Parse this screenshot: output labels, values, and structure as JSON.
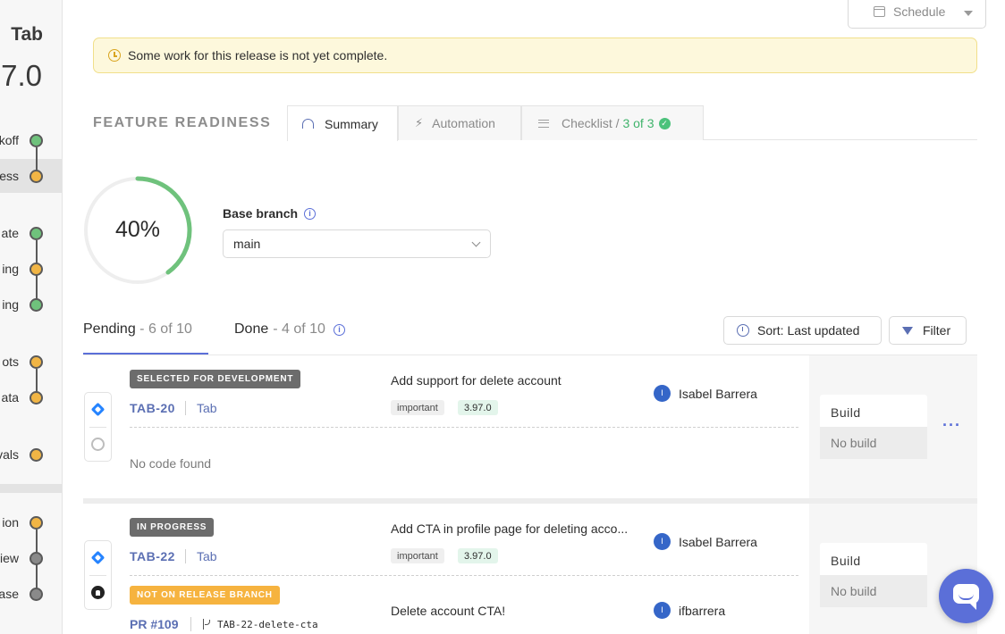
{
  "sidebar": {
    "title": "Tab",
    "version": "7.0",
    "steps": [
      {
        "label": "koff",
        "status": "green"
      },
      {
        "label": "ess",
        "status": "yellow",
        "active": true
      },
      {
        "label": "ate",
        "status": "green"
      },
      {
        "label": "ing",
        "status": "yellow"
      },
      {
        "label": "ing",
        "status": "green"
      },
      {
        "label": "ots",
        "status": "yellow"
      },
      {
        "label": "ata",
        "status": "yellow"
      },
      {
        "label": "vals",
        "status": "yellow"
      },
      {
        "label": "ion",
        "status": "yellow"
      },
      {
        "label": "iew",
        "status": "gray"
      },
      {
        "label": "ase",
        "status": "gray"
      }
    ]
  },
  "header": {
    "schedule_label": "Schedule"
  },
  "warning": {
    "text": "Some work for this release is not yet complete."
  },
  "readiness": {
    "title": "FEATURE READINESS",
    "tabs": {
      "summary": "Summary",
      "automation": "Automation",
      "checklist_prefix": "Checklist / ",
      "checklist_count": "3 of 3"
    },
    "progress_text": "40%",
    "progress_value": 0.4,
    "base_branch_label": "Base branch",
    "base_branch_value": "main"
  },
  "list": {
    "pending_label": "Pending",
    "pending_count": "- 6 of 10",
    "done_label": "Done",
    "done_count": "- 4 of 10",
    "sort_label": "Sort: Last updated",
    "filter_label": "Filter",
    "items": [
      {
        "status": "SELECTED FOR DEVELOPMENT",
        "key": "TAB-20",
        "project": "Tab",
        "title": "Add support for delete account",
        "tags": [
          "important",
          "3.97.0"
        ],
        "assignee": "Isabel Barrera",
        "assignee_initial": "I",
        "no_code": "No code found",
        "build_label": "Build",
        "build_value": "No build"
      },
      {
        "status": "IN PROGRESS",
        "key": "TAB-22",
        "project": "Tab",
        "title": "Add CTA in profile page for deleting acco...",
        "tags": [
          "important",
          "3.97.0"
        ],
        "assignee": "Isabel Barrera",
        "assignee_initial": "I",
        "pr_status": "NOT ON RELEASE BRANCH",
        "pr_number": "PR #109",
        "pr_branch": "TAB-22-delete-cta",
        "pr_title": "Delete account CTA!",
        "pr_author": "ifbarrera",
        "pr_author_initial": "I",
        "build_label": "Build",
        "build_value": "No build"
      }
    ],
    "more_label": "···"
  },
  "colors": {
    "accent": "#5b6fd8",
    "green": "#6fc27c",
    "yellow": "#f1b545",
    "warning_bg": "#fdf8dc"
  }
}
